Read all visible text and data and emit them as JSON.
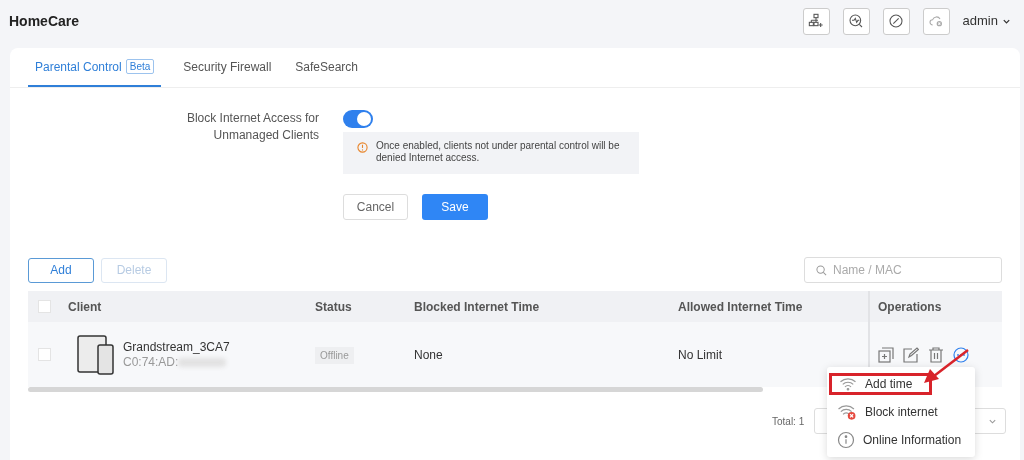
{
  "app_title": "HomeCare",
  "header_icons": [
    {
      "kind": "topology"
    },
    {
      "kind": "diagnose"
    },
    {
      "kind": "block"
    },
    {
      "kind": "cloud"
    }
  ],
  "user": "admin",
  "tabs": [
    {
      "label": "Parental Control",
      "badge": "Beta",
      "selected": true
    },
    {
      "label": "Security Firewall",
      "selected": false
    },
    {
      "label": "SafeSearch",
      "selected": false
    }
  ],
  "block_setting": {
    "label": "Block Internet Access for Unmanaged Clients",
    "on": true,
    "notice": "Once enabled, clients not under parental control will be denied Internet access."
  },
  "form_buttons": [
    "Cancel",
    "Save"
  ],
  "toolbar": {
    "add": "Add",
    "delete": "Delete",
    "delete_disabled": true,
    "search_placeholder": "Name / MAC"
  },
  "table": {
    "all_checked": false,
    "columns": [
      "Client",
      "Status",
      "Blocked Internet Time",
      "Allowed Internet Time",
      "Operations"
    ],
    "rows": [
      {
        "checked": false,
        "name": "Grandstream_3CA7",
        "mac": "C0:74:AD:",
        "status": "Offline",
        "blocked": "None",
        "allowed": "No Limit"
      }
    ]
  },
  "total": "Total: 1",
  "menu": [
    {
      "kind": "wifi",
      "label": "Add time",
      "highlighted": true
    },
    {
      "kind": "wifi-block",
      "label": "Block internet",
      "highlighted": false
    },
    {
      "kind": "info",
      "label": "Online Information",
      "highlighted": false
    }
  ]
}
